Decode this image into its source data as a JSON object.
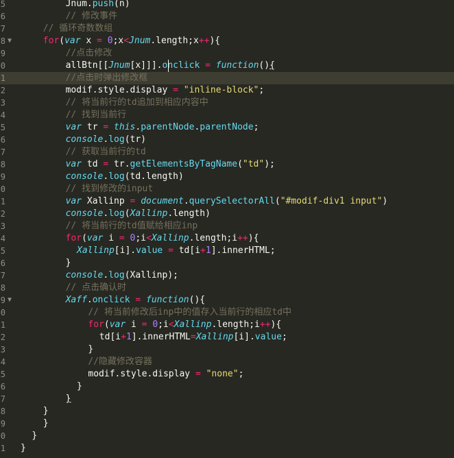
{
  "editor": {
    "colors": {
      "background": "#272822",
      "comment": "#75715e",
      "keyword": "#f92672",
      "string": "#e6db74",
      "number": "#ae81ff",
      "function": "#66d9ef"
    },
    "lines": [
      {
        "ln": "5",
        "fold": "",
        "indent": 8,
        "tokens": [
          [
            "pl",
            "Jnum."
          ],
          [
            "fn",
            "push"
          ],
          [
            "pl",
            "(n)"
          ]
        ]
      },
      {
        "ln": "6",
        "fold": "",
        "indent": 8,
        "tokens": [
          [
            "cm",
            "// 修改事件"
          ]
        ]
      },
      {
        "ln": "7",
        "fold": "",
        "indent": 4,
        "tokens": [
          [
            "cm",
            "// 循环奇数数组"
          ]
        ]
      },
      {
        "ln": "8",
        "fold": "▼",
        "indent": 4,
        "tokens": [
          [
            "kw",
            "for"
          ],
          [
            "pl",
            "("
          ],
          [
            "sp",
            "var"
          ],
          [
            "pl",
            " x "
          ],
          [
            "kw",
            "="
          ],
          [
            "pl",
            " "
          ],
          [
            "nm",
            "0"
          ],
          [
            "pl",
            ";x"
          ],
          [
            "kw",
            "<"
          ],
          [
            "vr",
            "Jnum"
          ],
          [
            "pl",
            ".length;x"
          ],
          [
            "kw",
            "++"
          ],
          [
            "pl",
            "){"
          ]
        ]
      },
      {
        "ln": "9",
        "fold": "",
        "indent": 8,
        "tokens": [
          [
            "cm",
            "//点击修改"
          ]
        ]
      },
      {
        "ln": "0",
        "fold": "",
        "indent": 8,
        "tokens": [
          [
            "pl",
            "allBtn[["
          ],
          [
            "vr",
            "Jnum"
          ],
          [
            "pl",
            "[x]]]."
          ],
          [
            "fn",
            "onclick"
          ],
          [
            "pl",
            " "
          ],
          [
            "kw",
            "="
          ],
          [
            "pl",
            " "
          ],
          [
            "sp",
            "function"
          ],
          [
            "pl",
            "()"
          ],
          [
            "ul",
            "{"
          ]
        ]
      },
      {
        "ln": "1",
        "fold": "",
        "indent": 8,
        "tokens": [
          [
            "cm",
            "//点击时弹出修改框"
          ]
        ]
      },
      {
        "ln": "2",
        "fold": "",
        "indent": 8,
        "tokens": [
          [
            "pl",
            "modif.style.display "
          ],
          [
            "kw",
            "="
          ],
          [
            "pl",
            " "
          ],
          [
            "st",
            "\"inline-block\""
          ],
          [
            "pl",
            ";"
          ]
        ]
      },
      {
        "ln": "3",
        "fold": "",
        "indent": 8,
        "tokens": [
          [
            "cm",
            "// 将当前行的td追加到相应内容中"
          ]
        ]
      },
      {
        "ln": "4",
        "fold": "",
        "indent": 8,
        "tokens": [
          [
            "cm",
            "// 找到当前行"
          ]
        ]
      },
      {
        "ln": "5",
        "fold": "",
        "indent": 8,
        "tokens": [
          [
            "sp",
            "var"
          ],
          [
            "pl",
            " tr "
          ],
          [
            "kw",
            "="
          ],
          [
            "pl",
            " "
          ],
          [
            "vr",
            "this"
          ],
          [
            "pl",
            "."
          ],
          [
            "fn",
            "parentNode"
          ],
          [
            "pl",
            "."
          ],
          [
            "fn",
            "parentNode"
          ],
          [
            "pl",
            ";"
          ]
        ]
      },
      {
        "ln": "6",
        "fold": "",
        "indent": 8,
        "tokens": [
          [
            "vr",
            "console"
          ],
          [
            "pl",
            "."
          ],
          [
            "fn",
            "log"
          ],
          [
            "pl",
            "(tr)"
          ]
        ]
      },
      {
        "ln": "7",
        "fold": "",
        "indent": 8,
        "tokens": [
          [
            "cm",
            "// 获取当前行的td"
          ]
        ]
      },
      {
        "ln": "8",
        "fold": "",
        "indent": 8,
        "tokens": [
          [
            "sp",
            "var"
          ],
          [
            "pl",
            " td "
          ],
          [
            "kw",
            "="
          ],
          [
            "pl",
            " tr."
          ],
          [
            "fn",
            "getElementsByTagName"
          ],
          [
            "pl",
            "("
          ],
          [
            "st",
            "\"td\""
          ],
          [
            "pl",
            ");"
          ]
        ]
      },
      {
        "ln": "9",
        "fold": "",
        "indent": 8,
        "tokens": [
          [
            "vr",
            "console"
          ],
          [
            "pl",
            "."
          ],
          [
            "fn",
            "log"
          ],
          [
            "pl",
            "(td.length)"
          ]
        ]
      },
      {
        "ln": "0",
        "fold": "",
        "indent": 8,
        "tokens": [
          [
            "cm",
            "// 找到修改的input"
          ]
        ]
      },
      {
        "ln": "1",
        "fold": "",
        "indent": 8,
        "tokens": [
          [
            "sp",
            "var"
          ],
          [
            "pl",
            " Xallinp "
          ],
          [
            "kw",
            "="
          ],
          [
            "pl",
            " "
          ],
          [
            "vr",
            "document"
          ],
          [
            "pl",
            "."
          ],
          [
            "fn",
            "querySelectorAll"
          ],
          [
            "pl",
            "("
          ],
          [
            "st",
            "\"#modif-div1 input\""
          ],
          [
            "pl",
            ")"
          ]
        ]
      },
      {
        "ln": "2",
        "fold": "",
        "indent": 8,
        "tokens": [
          [
            "vr",
            "console"
          ],
          [
            "pl",
            "."
          ],
          [
            "fn",
            "log"
          ],
          [
            "pl",
            "("
          ],
          [
            "vr",
            "Xallinp"
          ],
          [
            "pl",
            ".length)"
          ]
        ]
      },
      {
        "ln": "3",
        "fold": "",
        "indent": 8,
        "tokens": [
          [
            "cm",
            "// 将当前行的td值赋给相应inp"
          ]
        ]
      },
      {
        "ln": "4",
        "fold": "",
        "indent": 8,
        "tokens": [
          [
            "kw",
            "for"
          ],
          [
            "pl",
            "("
          ],
          [
            "sp",
            "var"
          ],
          [
            "pl",
            " i "
          ],
          [
            "kw",
            "="
          ],
          [
            "pl",
            " "
          ],
          [
            "nm",
            "0"
          ],
          [
            "pl",
            ";i"
          ],
          [
            "kw",
            "<"
          ],
          [
            "vr",
            "Xallinp"
          ],
          [
            "pl",
            ".length;i"
          ],
          [
            "kw",
            "++"
          ],
          [
            "pl",
            "){"
          ]
        ]
      },
      {
        "ln": "5",
        "fold": "",
        "indent": 10,
        "tokens": [
          [
            "vr",
            "Xallinp"
          ],
          [
            "pl",
            "[i]."
          ],
          [
            "fn",
            "value"
          ],
          [
            "pl",
            " "
          ],
          [
            "kw",
            "="
          ],
          [
            "pl",
            " td[i"
          ],
          [
            "kw",
            "+"
          ],
          [
            "nm",
            "1"
          ],
          [
            "pl",
            "].innerHTML;"
          ]
        ]
      },
      {
        "ln": "6",
        "fold": "",
        "indent": 8,
        "tokens": [
          [
            "pl",
            "}"
          ]
        ]
      },
      {
        "ln": "7",
        "fold": "",
        "indent": 8,
        "tokens": [
          [
            "vr",
            "console"
          ],
          [
            "pl",
            "."
          ],
          [
            "fn",
            "log"
          ],
          [
            "pl",
            "(Xallinp);"
          ]
        ]
      },
      {
        "ln": "8",
        "fold": "",
        "indent": 8,
        "tokens": [
          [
            "cm",
            "// 点击确认时"
          ]
        ]
      },
      {
        "ln": "9",
        "fold": "▼",
        "indent": 8,
        "tokens": [
          [
            "vr",
            "Xaff"
          ],
          [
            "pl",
            "."
          ],
          [
            "fn",
            "onclick"
          ],
          [
            "pl",
            " "
          ],
          [
            "kw",
            "="
          ],
          [
            "pl",
            " "
          ],
          [
            "sp",
            "function"
          ],
          [
            "pl",
            "(){"
          ]
        ]
      },
      {
        "ln": "0",
        "fold": "",
        "indent": 12,
        "tokens": [
          [
            "cm",
            "// 将当前修改后inp中的值存入当前行的相应td中"
          ]
        ]
      },
      {
        "ln": "1",
        "fold": "",
        "indent": 12,
        "tokens": [
          [
            "kw",
            "for"
          ],
          [
            "pl",
            "("
          ],
          [
            "sp",
            "var"
          ],
          [
            "pl",
            " i "
          ],
          [
            "kw",
            "="
          ],
          [
            "pl",
            " "
          ],
          [
            "nm",
            "0"
          ],
          [
            "pl",
            ";i"
          ],
          [
            "kw",
            "<"
          ],
          [
            "vr",
            "Xallinp"
          ],
          [
            "pl",
            ".length;i"
          ],
          [
            "kw",
            "++"
          ],
          [
            "pl",
            "){"
          ]
        ]
      },
      {
        "ln": "2",
        "fold": "",
        "indent": 14,
        "tokens": [
          [
            "pl",
            "td[i"
          ],
          [
            "kw",
            "+"
          ],
          [
            "nm",
            "1"
          ],
          [
            "pl",
            "].innerHTML"
          ],
          [
            "kw",
            "="
          ],
          [
            "vr",
            "Xallinp"
          ],
          [
            "pl",
            "[i]."
          ],
          [
            "fn",
            "value"
          ],
          [
            "pl",
            ";"
          ]
        ]
      },
      {
        "ln": "3",
        "fold": "",
        "indent": 12,
        "tokens": [
          [
            "pl",
            "}"
          ]
        ]
      },
      {
        "ln": "4",
        "fold": "",
        "indent": 12,
        "tokens": [
          [
            "cm",
            "//隐藏修改容器"
          ]
        ]
      },
      {
        "ln": "5",
        "fold": "",
        "indent": 12,
        "tokens": [
          [
            "pl",
            "modif.style.display "
          ],
          [
            "kw",
            "="
          ],
          [
            "pl",
            " "
          ],
          [
            "st",
            "\"none\""
          ],
          [
            "pl",
            ";"
          ]
        ]
      },
      {
        "ln": "6",
        "fold": "",
        "indent": 10,
        "tokens": [
          [
            "pl",
            "}"
          ]
        ]
      },
      {
        "ln": "7",
        "fold": "",
        "indent": 8,
        "tokens": [
          [
            "ul",
            "}"
          ]
        ]
      },
      {
        "ln": "8",
        "fold": "",
        "indent": 4,
        "tokens": [
          [
            "pl",
            "}"
          ]
        ]
      },
      {
        "ln": "9",
        "fold": "",
        "indent": 4,
        "tokens": [
          [
            "pl",
            "}"
          ]
        ]
      },
      {
        "ln": "0",
        "fold": "",
        "indent": 2,
        "tokens": [
          [
            "pl",
            "}"
          ]
        ]
      },
      {
        "ln": "1",
        "fold": "",
        "indent": 0,
        "tokens": [
          [
            "pl",
            "}"
          ]
        ]
      }
    ]
  }
}
